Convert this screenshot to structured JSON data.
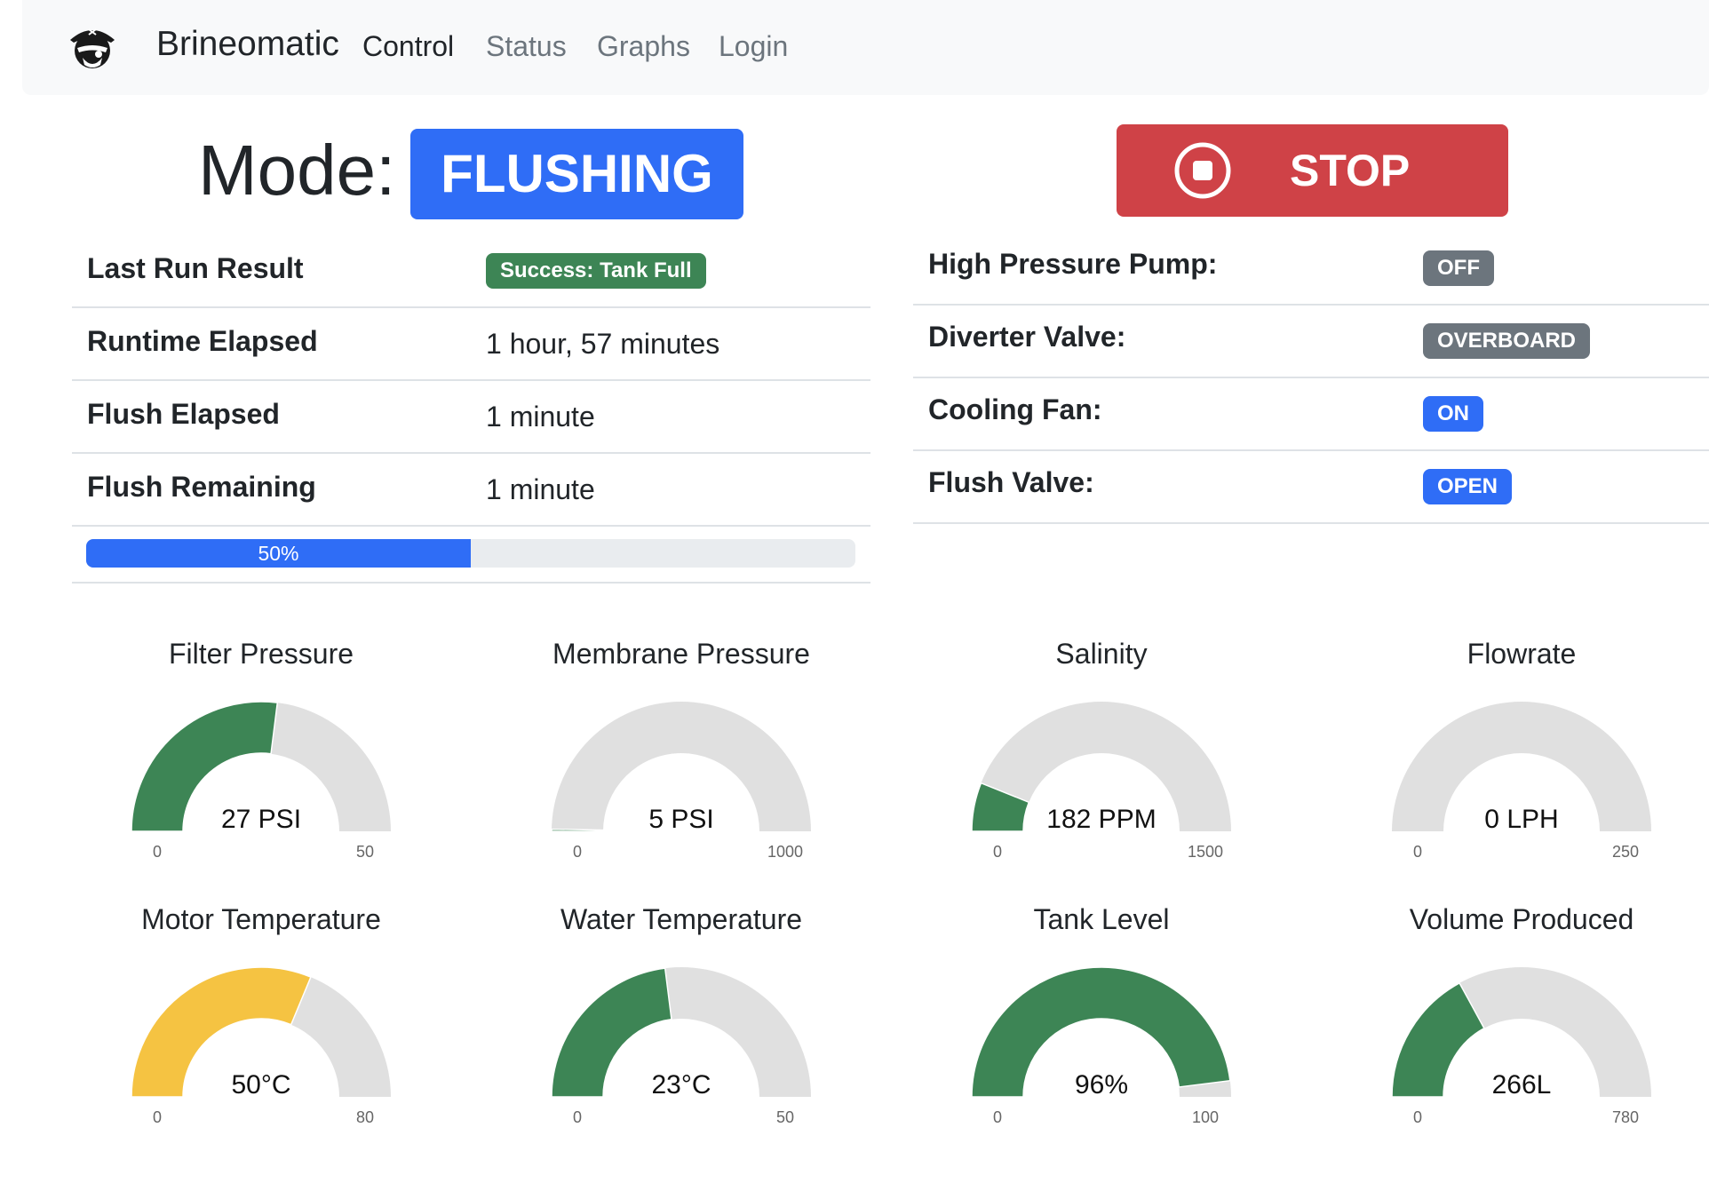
{
  "navbar": {
    "brand": "Brineomatic",
    "links": [
      {
        "label": "Control",
        "active": true
      },
      {
        "label": "Status",
        "active": false
      },
      {
        "label": "Graphs",
        "active": false
      },
      {
        "label": "Login",
        "active": false
      }
    ]
  },
  "mode": {
    "label": "Mode:",
    "value": "FLUSHING",
    "color": "#2f6df6"
  },
  "stop_button": {
    "label": "STOP",
    "color": "#cf4247",
    "icon": "stop-circle-icon"
  },
  "run_table": {
    "rows": [
      {
        "label": "Last Run Result",
        "badge": "Success: Tank Full",
        "badge_color": "#3d8555"
      },
      {
        "label": "Runtime Elapsed",
        "value": "1 hour, 57 minutes"
      },
      {
        "label": "Flush Elapsed",
        "value": "1 minute"
      },
      {
        "label": "Flush Remaining",
        "value": "1 minute"
      }
    ],
    "progress": {
      "percent": 50,
      "label": "50%",
      "color": "#2f6df6"
    }
  },
  "component_table": {
    "rows": [
      {
        "label": "High Pressure Pump:",
        "badge": "OFF",
        "badge_color": "#6c757d"
      },
      {
        "label": "Diverter Valve:",
        "badge": "OVERBOARD",
        "badge_color": "#6c757d"
      },
      {
        "label": "Cooling Fan:",
        "badge": "ON",
        "badge_color": "#2f6df6"
      },
      {
        "label": "Flush Valve:",
        "badge": "OPEN",
        "badge_color": "#2f6df6"
      }
    ]
  },
  "gauges": [
    {
      "title": "Filter Pressure",
      "value": 27,
      "display": "27 PSI",
      "min": "0",
      "max": "50",
      "min_value": 0,
      "max_value": 50,
      "color": "#3d8555"
    },
    {
      "title": "Membrane Pressure",
      "value": 5,
      "display": "5 PSI",
      "min": "0",
      "max": "1000",
      "min_value": 0,
      "max_value": 1000,
      "color": "#3d8555"
    },
    {
      "title": "Salinity",
      "value": 182,
      "display": "182 PPM",
      "min": "0",
      "max": "1500",
      "min_value": 0,
      "max_value": 1500,
      "color": "#3d8555"
    },
    {
      "title": "Flowrate",
      "value": 0,
      "display": "0 LPH",
      "min": "0",
      "max": "250",
      "min_value": 0,
      "max_value": 250,
      "color": "#3d8555"
    },
    {
      "title": "Motor Temperature",
      "value": 50,
      "display": "50°C",
      "min": "0",
      "max": "80",
      "min_value": 0,
      "max_value": 80,
      "color": "#f5c342"
    },
    {
      "title": "Water Temperature",
      "value": 23,
      "display": "23°C",
      "min": "0",
      "max": "50",
      "min_value": 0,
      "max_value": 50,
      "color": "#3d8555"
    },
    {
      "title": "Tank Level",
      "value": 96,
      "display": "96%",
      "min": "0",
      "max": "100",
      "min_value": 0,
      "max_value": 100,
      "color": "#3d8555"
    },
    {
      "title": "Volume Produced",
      "value": 266,
      "display": "266L",
      "min": "0",
      "max": "780",
      "min_value": 0,
      "max_value": 780,
      "color": "#3d8555"
    }
  ],
  "gauge_track_color": "#e0e0e0"
}
